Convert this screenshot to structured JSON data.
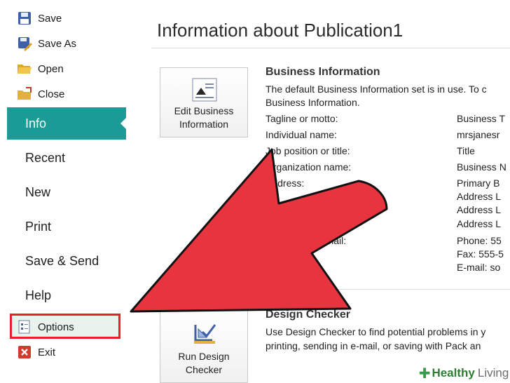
{
  "nav": {
    "save": "Save",
    "save_as": "Save As",
    "open": "Open",
    "close": "Close",
    "info": "Info",
    "recent": "Recent",
    "new": "New",
    "print": "Print",
    "save_send": "Save & Send",
    "help": "Help",
    "options": "Options",
    "exit": "Exit"
  },
  "main": {
    "title": "Information about Publication1",
    "business": {
      "button_line1": "Edit Business",
      "button_line2": "Information",
      "heading": "Business Information",
      "desc_line1": "The default Business Information set is in use. To c",
      "desc_line2": "Business Information.",
      "rows": [
        {
          "label": "Tagline or motto:",
          "value": "Business T"
        },
        {
          "label": "Individual name:",
          "value": "mrsjanesr"
        },
        {
          "label": "Job position or title:",
          "value": "Title"
        },
        {
          "label": "Organization name:",
          "value": "Business N"
        },
        {
          "label": "Address:",
          "value": "Primary B"
        },
        {
          "label": "",
          "value": "Address L"
        },
        {
          "label": "",
          "value": "Address L"
        },
        {
          "label": "",
          "value": "Address L"
        },
        {
          "label": "Phone/Fax/E-mail:",
          "value": "Phone: 55"
        },
        {
          "label": "",
          "value": "Fax: 555-5"
        },
        {
          "label": "",
          "value": "E-mail: so"
        }
      ]
    },
    "design": {
      "button_line1": "Run Design",
      "button_line2": "Checker",
      "heading": "Design Checker",
      "desc_line1": "Use Design Checker to find potential problems in y",
      "desc_line2": "printing, sending in e-mail, or saving with Pack an"
    }
  },
  "watermark": {
    "brand": "Healthy",
    "suffix": "Living"
  },
  "colors": {
    "accent": "#1a9b95",
    "highlight": "#e8202b",
    "arrow": "#e8343f"
  }
}
